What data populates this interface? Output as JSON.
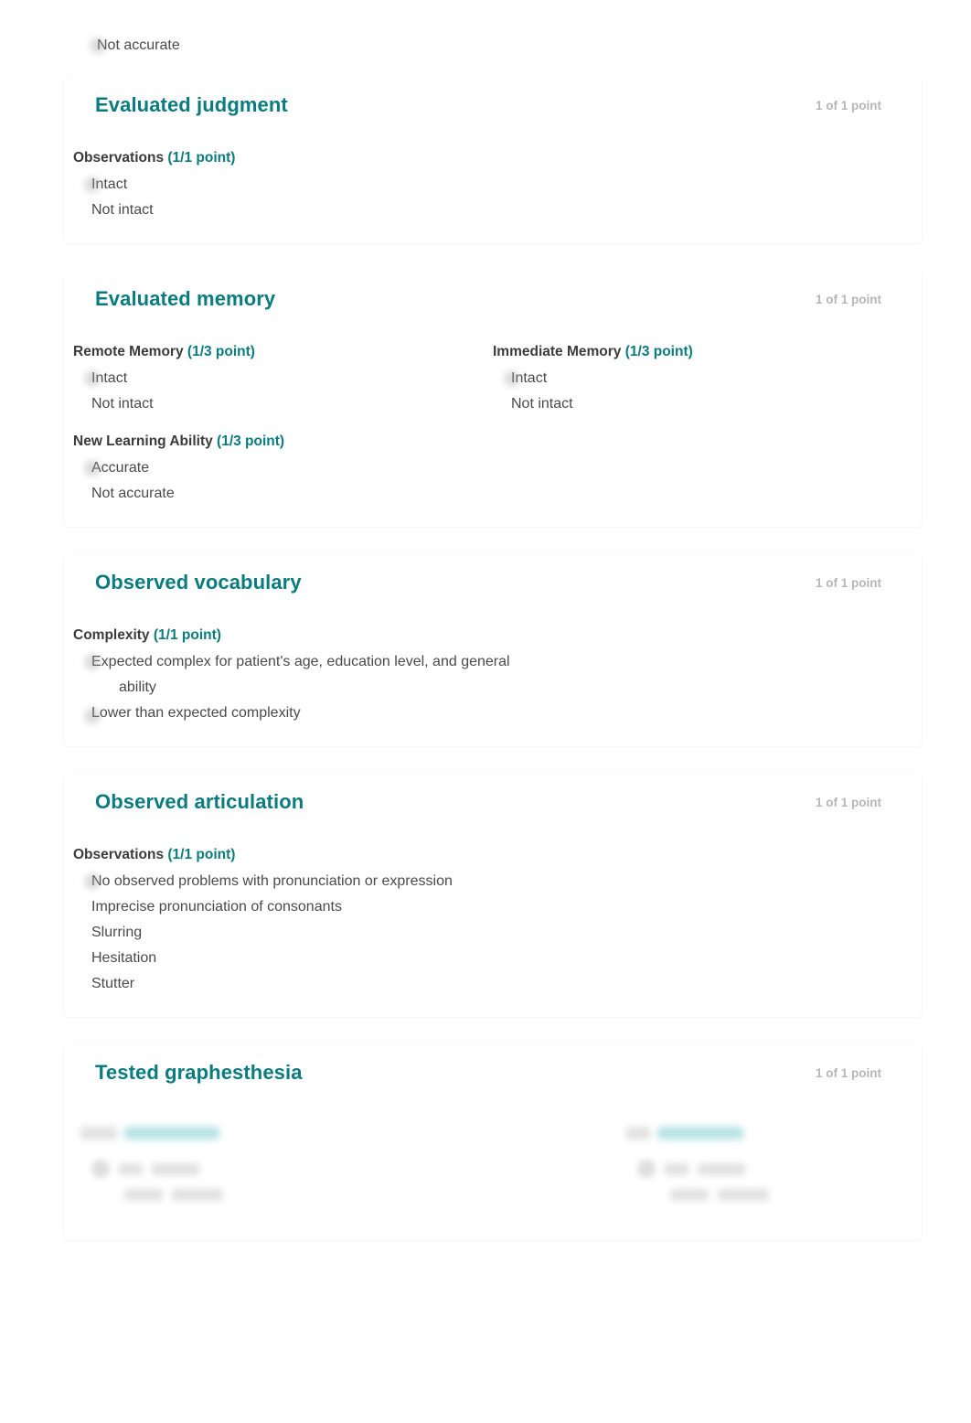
{
  "theme": {
    "accent_teal": "#0a7b7e",
    "points_gray": "#b6b6b6",
    "text_gray": "#4a4a4a",
    "page_background": "#ffffff"
  },
  "orphan_option": {
    "label": "Not accurate"
  },
  "sections": [
    {
      "title": "Evaluated judgment",
      "points": "1 of 1 point",
      "groups": [
        {
          "label": "Observations",
          "points": "(1/1 point)",
          "width": "full",
          "options": [
            "Intact",
            "Not intact"
          ]
        }
      ]
    },
    {
      "title": "Evaluated memory",
      "points": "1 of 1 point",
      "groups": [
        {
          "label": "Remote Memory",
          "points": "(1/3 point)",
          "width": "half",
          "options": [
            "Intact",
            "Not intact"
          ]
        },
        {
          "label": "Immediate Memory",
          "points": "(1/3 point)",
          "width": "half",
          "options": [
            "Intact",
            "Not intact"
          ]
        },
        {
          "label": "New Learning Ability",
          "points": "(1/3 point)",
          "width": "half",
          "options": [
            "Accurate",
            "Not accurate"
          ]
        }
      ]
    },
    {
      "title": "Observed vocabulary",
      "points": "1 of 1 point",
      "groups": [
        {
          "label": "Complexity",
          "points": "(1/1 point)",
          "width": "full",
          "options": [
            "Expected complex for patient's age, education level, and general ability",
            "Lower than expected complexity"
          ]
        }
      ]
    },
    {
      "title": "Observed articulation",
      "points": "1 of 1 point",
      "groups": [
        {
          "label": "Observations",
          "points": "(1/1 point)",
          "width": "full",
          "options": [
            "No observed problems with pronunciation or expression",
            "Imprecise pronunciation of consonants",
            "Slurring",
            "Hesitation",
            "Stutter"
          ]
        }
      ]
    },
    {
      "title": "Tested graphesthesia",
      "points": "1 of 1 point",
      "redacted": true,
      "groups": []
    }
  ]
}
